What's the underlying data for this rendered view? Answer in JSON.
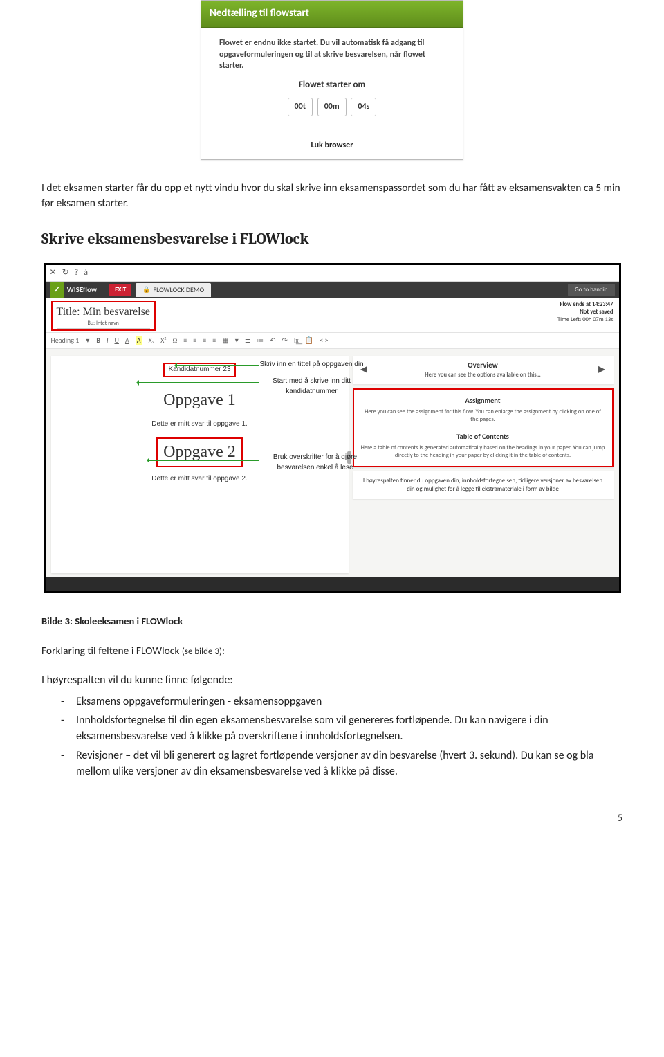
{
  "modal": {
    "title": "Nedtælling til flowstart",
    "message": "Flowet er endnu ikke startet. Du vil automatisk få adgang til opgaveformuleringen og til at skrive besvarelsen, når flowet starter.",
    "starts_label": "Flowet starter om",
    "countdown": {
      "h": "00t",
      "m": "00m",
      "s": "04s"
    },
    "close_label": "Luk browser"
  },
  "doc": {
    "para1": "I det eksamen starter får du opp et nytt vindu hvor du skal skrive inn eksamenspassordet som du har fått av eksamensvakten ca 5 min før eksamen starter.",
    "section_heading": "Skrive eksamensbesvarelse i FLOWlock",
    "caption": "Bilde 3: Skoleeksamen i FLOWlock",
    "explain_title_a": "Forklaring til feltene i FLOWlock ",
    "explain_title_b": "(se bilde 3)",
    "explain_title_c": ":",
    "list_intro": "I høyrespalten vil du kunne finne følgende:",
    "items": [
      "Eksamens oppgaveformuleringen - eksamensoppgaven",
      "Innholdsfortegnelse til din egen eksamensbesvarelse som vil genereres fortløpende. Du kan navigere i din eksamensbesvarelse ved å klikke på overskriftene i innholdsfortegnelsen.",
      "Revisjoner – det vil bli generert og lagret fortløpende versjoner av din besvarelse (hvert 3. sekund). Du kan se og bla mellom ulike versjoner av din eksamensbesvarelse ved å klikke på disse."
    ],
    "pagenum": "5"
  },
  "editor": {
    "iconrow": {
      "close": "✕",
      "refresh": "↻",
      "help": "?",
      "accented": "á"
    },
    "topbar": {
      "brand": "WISEflow",
      "exit": "EXIT",
      "tab": "FLOWLOCK DEMO",
      "handin": "Go to handin"
    },
    "title_box": {
      "line1": "Title: Min besvarelse",
      "line2": "Bu: Intet navn"
    },
    "status": {
      "ends": "Flow ends at 14:23:47",
      "saved": "Not yet saved",
      "time_left": "Time Left: 00h 07m 13s"
    },
    "toolbar": {
      "heading": "Heading 1",
      "dropdown": "▾",
      "bold": "B",
      "italic": "I",
      "underline": "U",
      "fontcolor": "A",
      "highlight": "A",
      "sub": "X₂",
      "sup": "X²",
      "omega": "Ω",
      "align_l": "≡",
      "align_c": "≡",
      "align_r": "≡",
      "align_j": "≡",
      "table": "▦",
      "drop2": "▾",
      "ol": "≣",
      "ul": "≔",
      "undo": "↶",
      "redo": "↷",
      "clear": "I͟x",
      "paste": "📋",
      "code": "< >"
    },
    "paper": {
      "cand": "Kandidatnummer 23",
      "h1": "Oppgave 1",
      "svar1": "Dette er mitt svar til oppgave 1.",
      "h2": "Oppgave 2",
      "svar2": "Dette er mitt svar til oppgave 2."
    },
    "callouts": {
      "c1": "Skriv inn en tittel på oppgaven din",
      "c2": "Start med å skrive inn ditt kandidatnummer",
      "c3": "Bruk overskrifter for å gjøre besvarelsen enkel å lese"
    },
    "side": {
      "overview_title": "Overview",
      "overview_sub": "Here you can see the options available on this…",
      "nav_left": "◀",
      "nav_right": "▶",
      "assignment_title": "Assignment",
      "assignment_body": "Here you can see the assignment for this flow. You can enlarge the assignment by clicking on one of the pages.",
      "toc_title": "Table of Contents",
      "toc_body": "Here a table of contents is generated automatically based on the headings in your paper. You can jump directly to the heading in your paper by clicking it in the table of contents.",
      "annotation": "I høyrespalten finner du oppgaven din, innholdsfortegnelsen, tidligere versjoner av besvarelsen din og mulighet for å legge til ekstramateriale i form av bilde"
    }
  }
}
